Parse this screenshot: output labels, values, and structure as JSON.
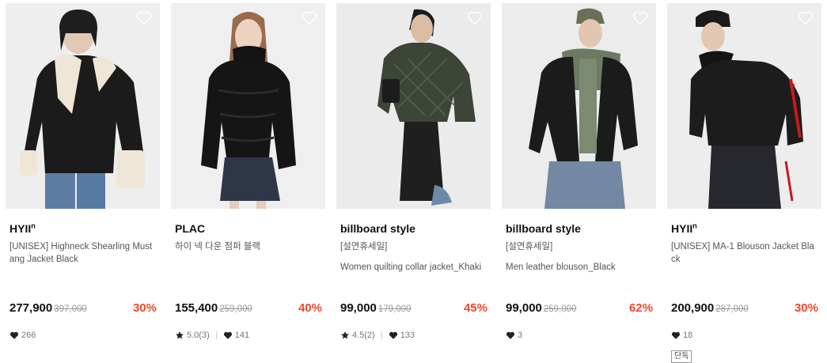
{
  "colors": {
    "discount": "#f0472c",
    "text": "#111111",
    "muted": "#777777",
    "strike": "#999999"
  },
  "products": [
    {
      "brand": "HYII",
      "brand_sup": "n",
      "name": "[UNISEX] Highneck Shearling Mustang Jacket Black",
      "name_alt": "",
      "price": "277,900",
      "original_price": "397,000",
      "discount": "30%",
      "rating": "",
      "likes": "266",
      "badge": "",
      "wishlist_icon": "heart-outline-icon"
    },
    {
      "brand": "PLAC",
      "brand_sup": "",
      "name": "하이 넥 다운 점퍼 블랙",
      "name_alt": "",
      "price": "155,400",
      "original_price": "259,000",
      "discount": "40%",
      "rating": "5.0(3)",
      "likes": "141",
      "badge": "",
      "wishlist_icon": "heart-outline-icon"
    },
    {
      "brand": "billboard style",
      "brand_sup": "",
      "name": "[설연휴세일]",
      "name_alt": "Women quilting collar jacket_Khaki",
      "price": "99,000",
      "original_price": "179,000",
      "discount": "45%",
      "rating": "4.5(2)",
      "likes": "133",
      "badge": "",
      "wishlist_icon": "heart-outline-icon"
    },
    {
      "brand": "billboard style",
      "brand_sup": "",
      "name": "[설연휴세일]",
      "name_alt": "Men leather blouson_Black",
      "price": "99,000",
      "original_price": "259,000",
      "discount": "62%",
      "rating": "",
      "likes": "3",
      "badge": "",
      "wishlist_icon": "heart-outline-icon"
    },
    {
      "brand": "HYII",
      "brand_sup": "n",
      "name": "[UNISEX] MA-1 Blouson Jacket Black",
      "name_alt": "",
      "price": "200,900",
      "original_price": "287,000",
      "discount": "30%",
      "rating": "",
      "likes": "18",
      "badge": "단독",
      "wishlist_icon": "heart-outline-icon"
    }
  ]
}
